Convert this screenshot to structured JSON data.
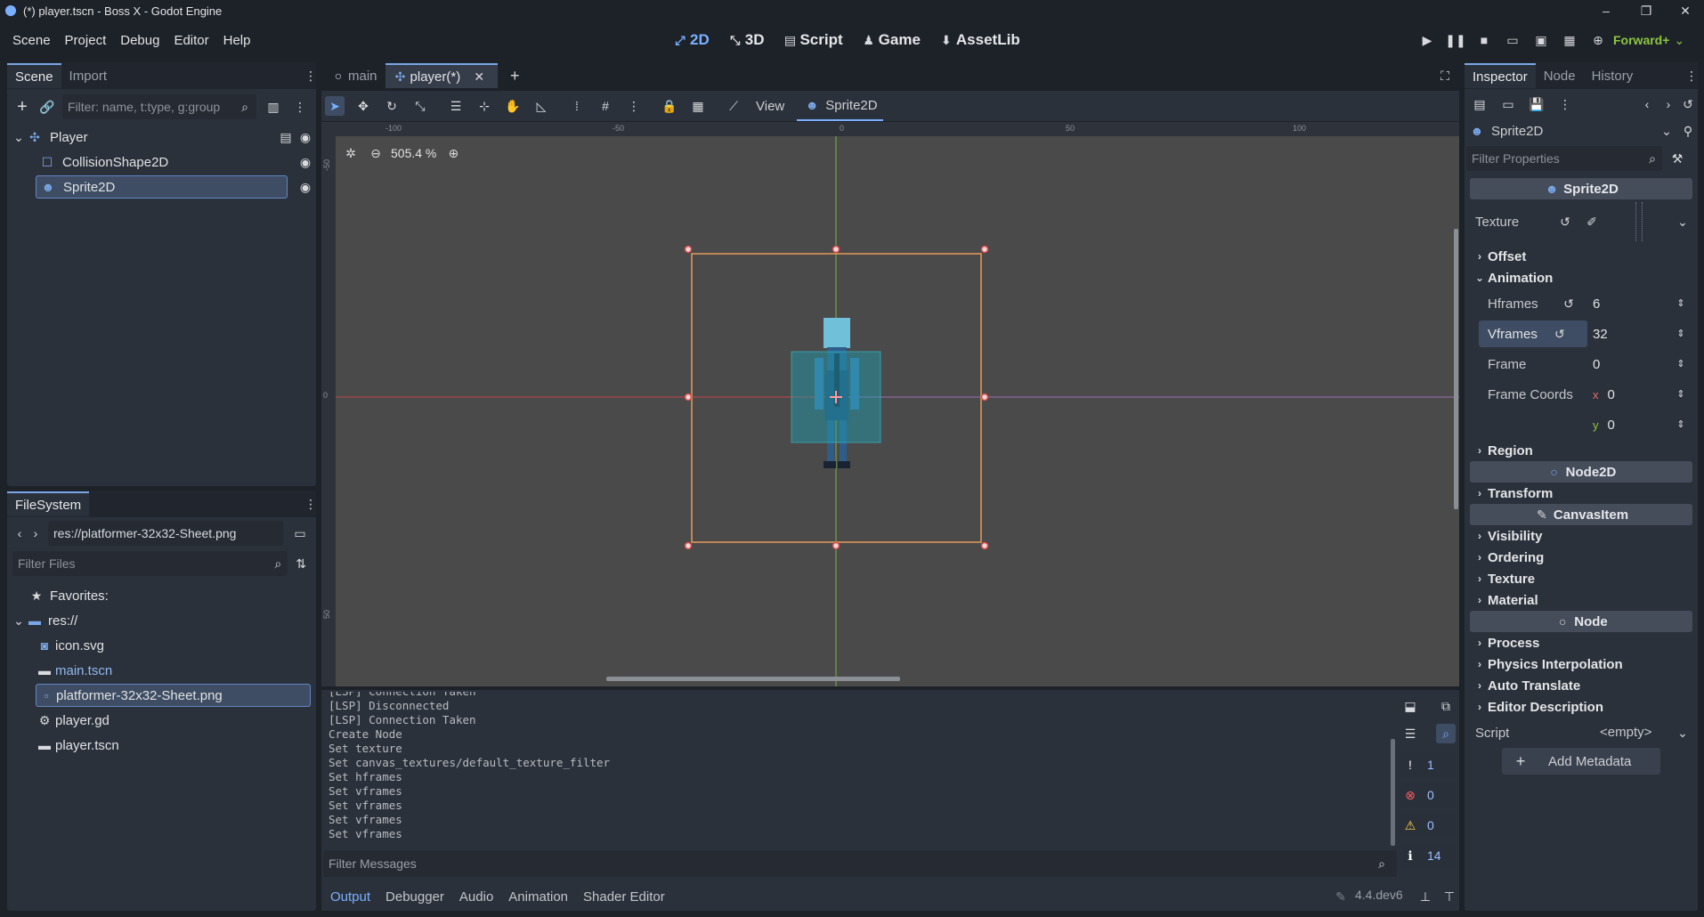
{
  "window": {
    "title": "(*) player.tscn - Boss X - Godot Engine"
  },
  "menu": [
    "Scene",
    "Project",
    "Debug",
    "Editor",
    "Help"
  ],
  "workspaces": [
    {
      "label": "2D",
      "icon": "2d-icon",
      "active": true
    },
    {
      "label": "3D",
      "icon": "3d-icon",
      "active": false
    },
    {
      "label": "Script",
      "icon": "script-icon",
      "active": false
    },
    {
      "label": "Game",
      "icon": "game-icon",
      "active": false
    },
    {
      "label": "AssetLib",
      "icon": "assetlib-icon",
      "active": false
    }
  ],
  "renderer": "Forward+",
  "scene_dock": {
    "tabs": [
      "Scene",
      "Import"
    ],
    "filter_placeholder": "Filter: name, t:type, g:group",
    "tree": [
      "Player",
      "CollisionShape2D",
      "Sprite2D"
    ]
  },
  "filesystem": {
    "tab": "FileSystem",
    "path": "res://platformer-32x32-Sheet.png",
    "filter_placeholder": "Filter Files",
    "items": [
      "Favorites:",
      "res://",
      "icon.svg",
      "main.tscn",
      "platformer-32x32-Sheet.png",
      "player.gd",
      "player.tscn"
    ]
  },
  "editor_tabs": [
    "main",
    "player(*)"
  ],
  "viewport": {
    "view_label": "View",
    "node_label": "Sprite2D",
    "zoom": "505.4 %",
    "ruler_x": [
      "-100",
      "-50",
      "0",
      "50",
      "100"
    ],
    "ruler_y": [
      "-50",
      "0",
      "50"
    ]
  },
  "output": {
    "lines": [
      "[LSP] Connection Taken",
      "[LSP] Disconnected",
      "[LSP] Connection Taken",
      "Create Node",
      "Set texture",
      "Set canvas_textures/default_texture_filter",
      "Set hframes",
      "Set vframes",
      "Set vframes",
      "Set vframes",
      "Set vframes"
    ],
    "filter_placeholder": "Filter Messages",
    "counts": {
      "messages": "1",
      "errors": "0",
      "warnings": "0",
      "info": "14"
    }
  },
  "bottom_tabs": [
    "Output",
    "Debugger",
    "Audio",
    "Animation",
    "Shader Editor"
  ],
  "version": "4.4.dev6",
  "inspector": {
    "tabs": [
      "Inspector",
      "Node",
      "History"
    ],
    "object": "Sprite2D",
    "filter_placeholder": "Filter Properties",
    "class_header": "Sprite2D",
    "texture_label": "Texture",
    "cat_offset": "Offset",
    "cat_animation": "Animation",
    "hframes_label": "Hframes",
    "hframes": "6",
    "vframes_label": "Vframes",
    "vframes": "32",
    "frame_label": "Frame",
    "frame": "0",
    "frame_coords_label": "Frame Coords",
    "coord_x_label": "x",
    "coord_x": "0",
    "coord_y_label": "y",
    "coord_y": "0",
    "cat_region": "Region",
    "node2d_header": "Node2D",
    "cat_transform": "Transform",
    "canvasitem_header": "CanvasItem",
    "canvas_cats": [
      "Visibility",
      "Ordering",
      "Texture",
      "Material"
    ],
    "node_header": "Node",
    "node_cats": [
      "Process",
      "Physics Interpolation",
      "Auto Translate",
      "Editor Description"
    ],
    "script_label": "Script",
    "script_value": "<empty>",
    "add_metadata": "Add Metadata"
  },
  "colors": {
    "accent": "#7ab0ff",
    "background": "#1d2229",
    "panel": "#363d4a",
    "canvas": "#4a4a4a"
  }
}
